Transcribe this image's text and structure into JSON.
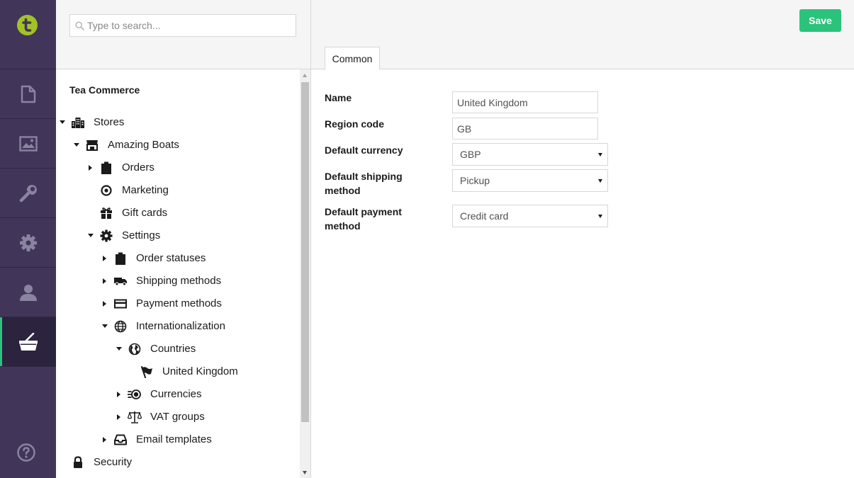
{
  "colors": {
    "sidebar_bg": "#413659",
    "accent_green": "#2bc37c",
    "logo_green": "#a3c226"
  },
  "appbar": {
    "logo_icon": "tea-commerce-logo-icon",
    "sections": [
      {
        "name": "content",
        "icon": "document-icon"
      },
      {
        "name": "media",
        "icon": "image-icon"
      },
      {
        "name": "developer",
        "icon": "wrench-icon"
      },
      {
        "name": "settings",
        "icon": "gear-icon"
      },
      {
        "name": "members",
        "icon": "user-icon"
      },
      {
        "name": "tea-commerce",
        "icon": "basket-icon",
        "active": true
      }
    ],
    "help_icon": "help-icon"
  },
  "search": {
    "placeholder": "Type to search..."
  },
  "tree": {
    "title": "Tea Commerce",
    "nodes": [
      {
        "label": "Stores",
        "icon": "buildings-icon",
        "expanded": true
      },
      {
        "label": "Amazing Boats",
        "icon": "store-icon",
        "expanded": true
      },
      {
        "label": "Orders",
        "icon": "clipboard-icon",
        "expanded": false
      },
      {
        "label": "Marketing",
        "icon": "target-icon"
      },
      {
        "label": "Gift cards",
        "icon": "gift-icon"
      },
      {
        "label": "Settings",
        "icon": "gear-icon",
        "expanded": true
      },
      {
        "label": "Order statuses",
        "icon": "clipboard-icon",
        "expanded": false
      },
      {
        "label": "Shipping methods",
        "icon": "truck-icon",
        "expanded": false
      },
      {
        "label": "Payment methods",
        "icon": "credit-card-icon",
        "expanded": false
      },
      {
        "label": "Internationalization",
        "icon": "globe-icon",
        "expanded": true
      },
      {
        "label": "Countries",
        "icon": "earth-icon",
        "expanded": true
      },
      {
        "label": "United Kingdom",
        "icon": "flag-icon"
      },
      {
        "label": "Currencies",
        "icon": "coins-icon",
        "expanded": false
      },
      {
        "label": "VAT groups",
        "icon": "scales-icon",
        "expanded": false
      },
      {
        "label": "Email templates",
        "icon": "inbox-icon",
        "expanded": false
      },
      {
        "label": "Security",
        "icon": "lock-icon"
      }
    ]
  },
  "editor": {
    "save_label": "Save",
    "tabs": [
      {
        "label": "Common",
        "active": true
      }
    ],
    "fields": {
      "name": {
        "label": "Name",
        "value": "United Kingdom"
      },
      "region_code": {
        "label": "Region code",
        "value": "GB"
      },
      "default_currency": {
        "label": "Default currency",
        "value": "GBP"
      },
      "default_shipping_method": {
        "label_line1": "Default shipping",
        "label_line2": "method",
        "value": "Pickup"
      },
      "default_payment_method": {
        "label_line1": "Default payment",
        "label_line2": "method",
        "value": "Credit card"
      }
    }
  }
}
